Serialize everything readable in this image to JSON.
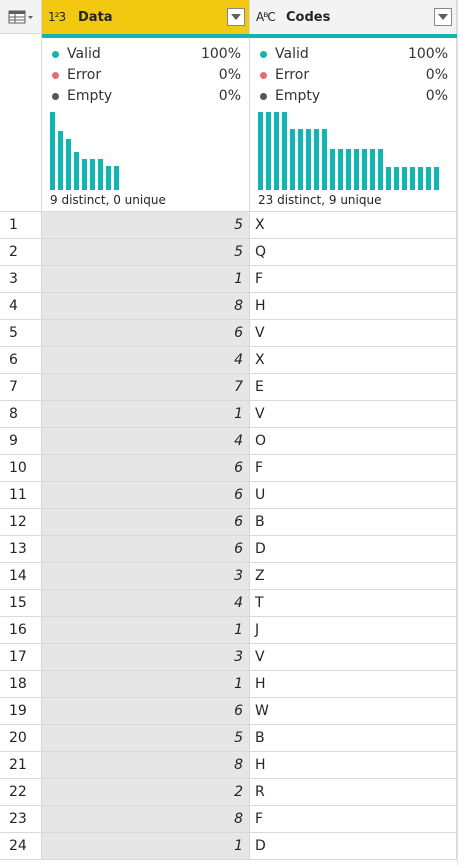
{
  "columns": {
    "data": {
      "type_icon": "1²3",
      "title": "Data"
    },
    "codes": {
      "type_icon": "AᴮC",
      "title": "Codes"
    }
  },
  "profile": {
    "data": {
      "valid_label": "Valid",
      "valid_pct": "100%",
      "error_label": "Error",
      "error_pct": "0%",
      "empty_label": "Empty",
      "empty_pct": "0%",
      "distinct": "9 distinct, 0 unique",
      "histogram": [
        1.0,
        0.76,
        0.66,
        0.49,
        0.4,
        0.4,
        0.4,
        0.31,
        0.31
      ]
    },
    "codes": {
      "valid_label": "Valid",
      "valid_pct": "100%",
      "error_label": "Error",
      "error_pct": "0%",
      "empty_label": "Empty",
      "empty_pct": "0%",
      "distinct": "23 distinct, 9 unique",
      "histogram": [
        1.0,
        1.0,
        1.0,
        1.0,
        0.78,
        0.78,
        0.78,
        0.78,
        0.78,
        0.53,
        0.53,
        0.53,
        0.53,
        0.53,
        0.53,
        0.53,
        0.29,
        0.29,
        0.29,
        0.29,
        0.29,
        0.29,
        0.29
      ]
    }
  },
  "colors": {
    "valid": "#0fb5ae",
    "error": "#e66c6c",
    "empty": "#555555",
    "header_active": "#f2c811"
  },
  "rows": [
    {
      "n": "1",
      "data": "5",
      "code": "X"
    },
    {
      "n": "2",
      "data": "5",
      "code": "Q"
    },
    {
      "n": "3",
      "data": "1",
      "code": "F"
    },
    {
      "n": "4",
      "data": "8",
      "code": "H"
    },
    {
      "n": "5",
      "data": "6",
      "code": "V"
    },
    {
      "n": "6",
      "data": "4",
      "code": "X"
    },
    {
      "n": "7",
      "data": "7",
      "code": "E"
    },
    {
      "n": "8",
      "data": "1",
      "code": "V"
    },
    {
      "n": "9",
      "data": "4",
      "code": "O"
    },
    {
      "n": "10",
      "data": "6",
      "code": "F"
    },
    {
      "n": "11",
      "data": "6",
      "code": "U"
    },
    {
      "n": "12",
      "data": "6",
      "code": "B"
    },
    {
      "n": "13",
      "data": "6",
      "code": "D"
    },
    {
      "n": "14",
      "data": "3",
      "code": "Z"
    },
    {
      "n": "15",
      "data": "4",
      "code": "T"
    },
    {
      "n": "16",
      "data": "1",
      "code": "J"
    },
    {
      "n": "17",
      "data": "3",
      "code": "V"
    },
    {
      "n": "18",
      "data": "1",
      "code": "H"
    },
    {
      "n": "19",
      "data": "6",
      "code": "W"
    },
    {
      "n": "20",
      "data": "5",
      "code": "B"
    },
    {
      "n": "21",
      "data": "8",
      "code": "H"
    },
    {
      "n": "22",
      "data": "2",
      "code": "R"
    },
    {
      "n": "23",
      "data": "8",
      "code": "F"
    },
    {
      "n": "24",
      "data": "1",
      "code": "D"
    }
  ]
}
